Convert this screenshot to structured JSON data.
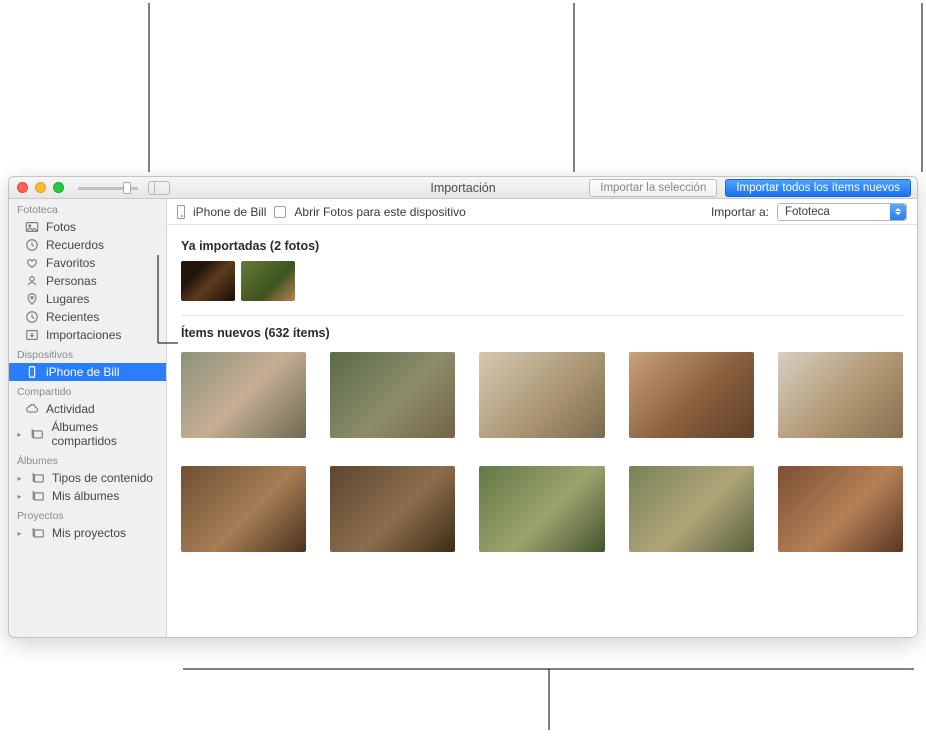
{
  "window": {
    "title": "Importación"
  },
  "toolbar": {
    "import_selection_label": "Importar la selección",
    "import_all_label": "Importar todos los ítems nuevos"
  },
  "device_bar": {
    "device_name": "iPhone de Bill",
    "open_photos_label": "Abrir Fotos para este dispositivo",
    "import_to_label": "Importar a:",
    "import_to_value": "Fototeca"
  },
  "sections": {
    "already_imported": {
      "title": "Ya importadas (2 fotos)",
      "thumbs": [
        {
          "bg": "linear-gradient(135deg,#24150c 30%,#5d3c1e 55%,#1a0e07)"
        },
        {
          "bg": "linear-gradient(135deg,#6a7a3a,#3c531f 60%,#b88454)"
        }
      ]
    },
    "new_items": {
      "title": "Ítems nuevos (632 ítems)",
      "thumbs": [
        {
          "bg": "linear-gradient(135deg,#8c9279,#c6ae95 50%,#6d6b51)"
        },
        {
          "bg": "linear-gradient(135deg,#5a6b48,#8d8c6a 55%,#726449)"
        },
        {
          "bg": "linear-gradient(135deg,#d6c8b1,#a89371 60%,#7a6a4c)"
        },
        {
          "bg": "linear-gradient(135deg,#c9a27b,#8a5f3e 55%,#5f4028)"
        },
        {
          "bg": "linear-gradient(135deg,#d7cfc2,#b29773 55%,#85704e)"
        },
        {
          "bg": "linear-gradient(135deg,#6e4f34,#a67e55 55%,#4b321d)"
        },
        {
          "bg": "linear-gradient(135deg,#5c4631,#8c6e4c 55%,#3d2c18)"
        },
        {
          "bg": "linear-gradient(135deg,#617845,#9da36f 55%,#44532c)"
        },
        {
          "bg": "linear-gradient(135deg,#778257,#b0a579 55%,#56603b)"
        },
        {
          "bg": "linear-gradient(135deg,#7b4f34,#b58156 55%,#5a3621)"
        }
      ]
    }
  },
  "sidebar": {
    "groups": [
      {
        "header": "Fototeca",
        "items": [
          {
            "label": "Fotos",
            "icon": "photos"
          },
          {
            "label": "Recuerdos",
            "icon": "clock"
          },
          {
            "label": "Favoritos",
            "icon": "heart"
          },
          {
            "label": "Personas",
            "icon": "person"
          },
          {
            "label": "Lugares",
            "icon": "pin"
          },
          {
            "label": "Recientes",
            "icon": "recent"
          },
          {
            "label": "Importaciones",
            "icon": "import"
          }
        ]
      },
      {
        "header": "Dispositivos",
        "items": [
          {
            "label": "iPhone de Bill",
            "icon": "phone",
            "selected": true
          }
        ]
      },
      {
        "header": "Compartido",
        "items": [
          {
            "label": "Actividad",
            "icon": "cloud"
          },
          {
            "label": "Álbumes compartidos",
            "icon": "album",
            "disclosure": true
          }
        ]
      },
      {
        "header": "Álbumes",
        "items": [
          {
            "label": "Tipos de contenido",
            "icon": "album",
            "disclosure": true
          },
          {
            "label": "Mis álbumes",
            "icon": "album",
            "disclosure": true
          }
        ]
      },
      {
        "header": "Proyectos",
        "items": [
          {
            "label": "Mis proyectos",
            "icon": "album",
            "disclosure": true
          }
        ]
      }
    ]
  }
}
